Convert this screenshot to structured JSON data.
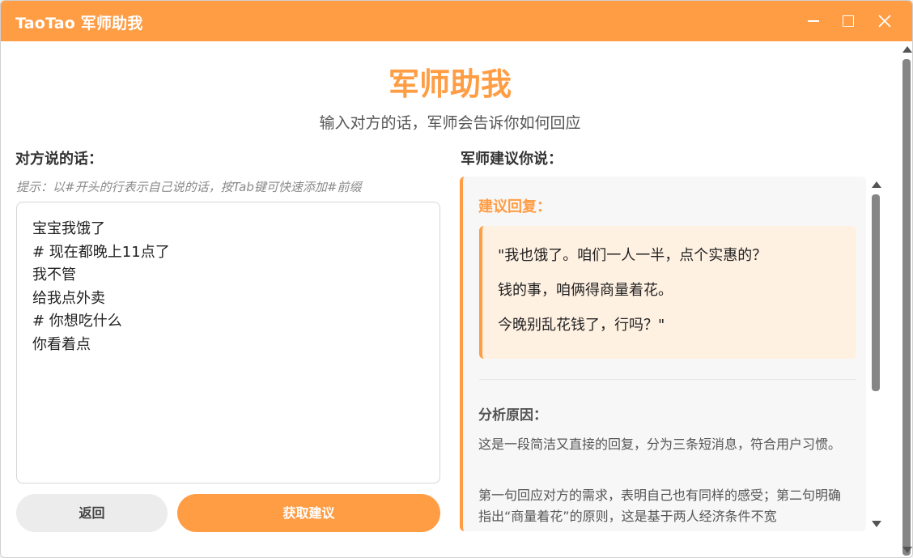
{
  "window": {
    "title": "TaoTao 军师助我",
    "controls": [
      "minimize-icon",
      "maximize-icon",
      "close-icon"
    ]
  },
  "header": {
    "title": "军师助我",
    "subtitle": "输入对方的话，军师会告诉你如何回应"
  },
  "left": {
    "label": "对方说的话：",
    "hint": "提示：以#开头的行表示自己说的话，按Tab键可快速添加#前缀",
    "lines": [
      "宝宝我饿了",
      "# 现在都晚上11点了",
      "我不管",
      "给我点外卖",
      "# 你想吃什么",
      "你看着点"
    ],
    "back_label": "返回",
    "get_label": "获取建议"
  },
  "right": {
    "label": "军师建议你说：",
    "suggestion_title": "建议回复：",
    "reply_lines": [
      "\"我也饿了。咱们一人一半，点个实惠的？",
      "钱的事，咱俩得商量着花。",
      "今晚别乱花钱了，行吗？\""
    ],
    "analysis_title": "分析原因：",
    "analysis_paragraphs": [
      "这是一段简洁又直接的回复，分为三条短消息，符合用户习惯。",
      "第一句回应对方的需求，表明自己也有同样的感受；第二句明确指出“商量着花”的原则，这是基于两人经济条件不宽"
    ]
  },
  "colors": {
    "accent": "#ff9d45",
    "reply_bg": "#fff1e2"
  }
}
